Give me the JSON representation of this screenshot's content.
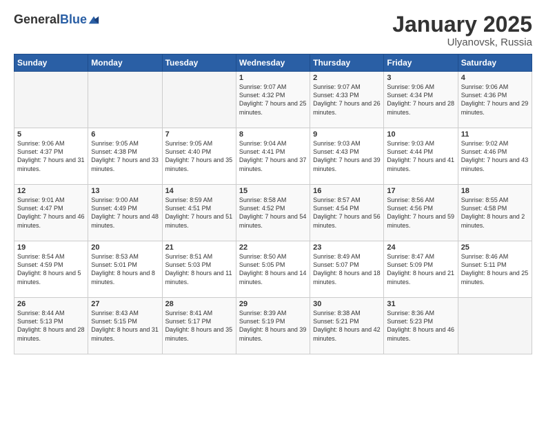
{
  "logo": {
    "general": "General",
    "blue": "Blue"
  },
  "header": {
    "month": "January 2025",
    "location": "Ulyanovsk, Russia"
  },
  "days_of_week": [
    "Sunday",
    "Monday",
    "Tuesday",
    "Wednesday",
    "Thursday",
    "Friday",
    "Saturday"
  ],
  "weeks": [
    [
      {
        "day": "",
        "info": ""
      },
      {
        "day": "",
        "info": ""
      },
      {
        "day": "",
        "info": ""
      },
      {
        "day": "1",
        "info": "Sunrise: 9:07 AM\nSunset: 4:32 PM\nDaylight: 7 hours\nand 25 minutes."
      },
      {
        "day": "2",
        "info": "Sunrise: 9:07 AM\nSunset: 4:33 PM\nDaylight: 7 hours\nand 26 minutes."
      },
      {
        "day": "3",
        "info": "Sunrise: 9:06 AM\nSunset: 4:34 PM\nDaylight: 7 hours\nand 28 minutes."
      },
      {
        "day": "4",
        "info": "Sunrise: 9:06 AM\nSunset: 4:36 PM\nDaylight: 7 hours\nand 29 minutes."
      }
    ],
    [
      {
        "day": "5",
        "info": "Sunrise: 9:06 AM\nSunset: 4:37 PM\nDaylight: 7 hours\nand 31 minutes."
      },
      {
        "day": "6",
        "info": "Sunrise: 9:05 AM\nSunset: 4:38 PM\nDaylight: 7 hours\nand 33 minutes."
      },
      {
        "day": "7",
        "info": "Sunrise: 9:05 AM\nSunset: 4:40 PM\nDaylight: 7 hours\nand 35 minutes."
      },
      {
        "day": "8",
        "info": "Sunrise: 9:04 AM\nSunset: 4:41 PM\nDaylight: 7 hours\nand 37 minutes."
      },
      {
        "day": "9",
        "info": "Sunrise: 9:03 AM\nSunset: 4:43 PM\nDaylight: 7 hours\nand 39 minutes."
      },
      {
        "day": "10",
        "info": "Sunrise: 9:03 AM\nSunset: 4:44 PM\nDaylight: 7 hours\nand 41 minutes."
      },
      {
        "day": "11",
        "info": "Sunrise: 9:02 AM\nSunset: 4:46 PM\nDaylight: 7 hours\nand 43 minutes."
      }
    ],
    [
      {
        "day": "12",
        "info": "Sunrise: 9:01 AM\nSunset: 4:47 PM\nDaylight: 7 hours\nand 46 minutes."
      },
      {
        "day": "13",
        "info": "Sunrise: 9:00 AM\nSunset: 4:49 PM\nDaylight: 7 hours\nand 48 minutes."
      },
      {
        "day": "14",
        "info": "Sunrise: 8:59 AM\nSunset: 4:51 PM\nDaylight: 7 hours\nand 51 minutes."
      },
      {
        "day": "15",
        "info": "Sunrise: 8:58 AM\nSunset: 4:52 PM\nDaylight: 7 hours\nand 54 minutes."
      },
      {
        "day": "16",
        "info": "Sunrise: 8:57 AM\nSunset: 4:54 PM\nDaylight: 7 hours\nand 56 minutes."
      },
      {
        "day": "17",
        "info": "Sunrise: 8:56 AM\nSunset: 4:56 PM\nDaylight: 7 hours\nand 59 minutes."
      },
      {
        "day": "18",
        "info": "Sunrise: 8:55 AM\nSunset: 4:58 PM\nDaylight: 8 hours\nand 2 minutes."
      }
    ],
    [
      {
        "day": "19",
        "info": "Sunrise: 8:54 AM\nSunset: 4:59 PM\nDaylight: 8 hours\nand 5 minutes."
      },
      {
        "day": "20",
        "info": "Sunrise: 8:53 AM\nSunset: 5:01 PM\nDaylight: 8 hours\nand 8 minutes."
      },
      {
        "day": "21",
        "info": "Sunrise: 8:51 AM\nSunset: 5:03 PM\nDaylight: 8 hours\nand 11 minutes."
      },
      {
        "day": "22",
        "info": "Sunrise: 8:50 AM\nSunset: 5:05 PM\nDaylight: 8 hours\nand 14 minutes."
      },
      {
        "day": "23",
        "info": "Sunrise: 8:49 AM\nSunset: 5:07 PM\nDaylight: 8 hours\nand 18 minutes."
      },
      {
        "day": "24",
        "info": "Sunrise: 8:47 AM\nSunset: 5:09 PM\nDaylight: 8 hours\nand 21 minutes."
      },
      {
        "day": "25",
        "info": "Sunrise: 8:46 AM\nSunset: 5:11 PM\nDaylight: 8 hours\nand 25 minutes."
      }
    ],
    [
      {
        "day": "26",
        "info": "Sunrise: 8:44 AM\nSunset: 5:13 PM\nDaylight: 8 hours\nand 28 minutes."
      },
      {
        "day": "27",
        "info": "Sunrise: 8:43 AM\nSunset: 5:15 PM\nDaylight: 8 hours\nand 31 minutes."
      },
      {
        "day": "28",
        "info": "Sunrise: 8:41 AM\nSunset: 5:17 PM\nDaylight: 8 hours\nand 35 minutes."
      },
      {
        "day": "29",
        "info": "Sunrise: 8:39 AM\nSunset: 5:19 PM\nDaylight: 8 hours\nand 39 minutes."
      },
      {
        "day": "30",
        "info": "Sunrise: 8:38 AM\nSunset: 5:21 PM\nDaylight: 8 hours\nand 42 minutes."
      },
      {
        "day": "31",
        "info": "Sunrise: 8:36 AM\nSunset: 5:23 PM\nDaylight: 8 hours\nand 46 minutes."
      },
      {
        "day": "",
        "info": ""
      }
    ]
  ]
}
